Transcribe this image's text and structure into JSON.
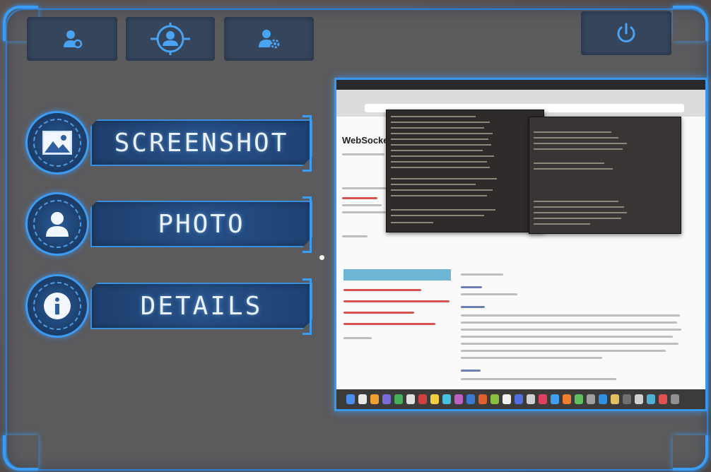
{
  "toolbar": {
    "user_location_icon": "user-pin-icon",
    "target_user_icon": "target-user-icon",
    "user_settings_icon": "user-gear-icon",
    "power_icon": "power-icon"
  },
  "menu": {
    "screenshot_label": "SCREENSHOT",
    "photo_label": "PHOTO",
    "details_label": "DETAILS",
    "screenshot_icon": "image-icon",
    "photo_icon": "person-icon",
    "details_icon": "info-icon"
  },
  "preview": {
    "page_title": "WebSocket"
  },
  "colors": {
    "accent": "#3a97f0",
    "panel": "#5b5a5c",
    "button": "#34455c",
    "label": "#e9f1fb"
  }
}
